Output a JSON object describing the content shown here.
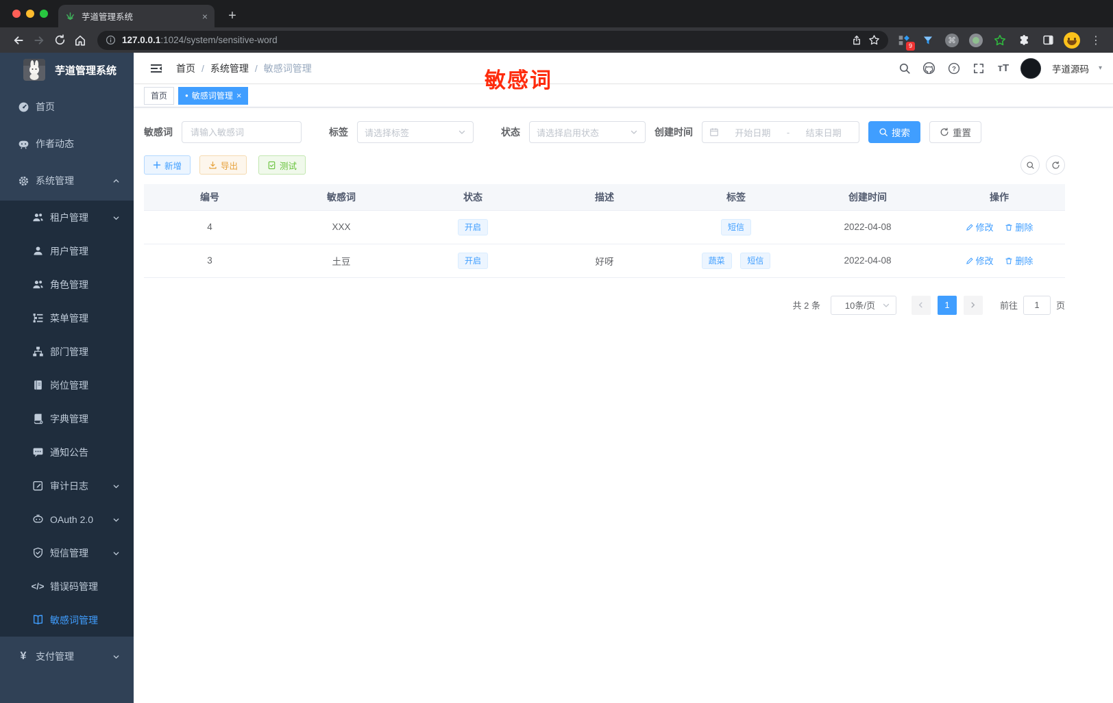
{
  "browser": {
    "tab_title": "芋道管理系统",
    "url_host": "127.0.0.1",
    "url_rest": ":1024/system/sensitive-word",
    "extension_badge": "9"
  },
  "icons": {
    "newtab": "+",
    "close": "×",
    "dot": "●",
    "question": "?",
    "command": "⌘",
    "fontsize": "тT",
    "kebab": "⋮",
    "code": "</>",
    "yen": "¥",
    "caret": "▾"
  },
  "sidebar": {
    "logo_title": "芋道管理系统",
    "items": [
      {
        "label": "首页"
      },
      {
        "label": "作者动态"
      },
      {
        "label": "系统管理"
      },
      {
        "label": "租户管理"
      },
      {
        "label": "用户管理"
      },
      {
        "label": "角色管理"
      },
      {
        "label": "菜单管理"
      },
      {
        "label": "部门管理"
      },
      {
        "label": "岗位管理"
      },
      {
        "label": "字典管理"
      },
      {
        "label": "通知公告"
      },
      {
        "label": "审计日志"
      },
      {
        "label": "OAuth 2.0"
      },
      {
        "label": "短信管理"
      },
      {
        "label": "错误码管理"
      },
      {
        "label": "敏感词管理"
      },
      {
        "label": "支付管理"
      }
    ]
  },
  "header": {
    "breadcrumb": [
      "首页",
      "系统管理",
      "敏感词管理"
    ],
    "separator": "/",
    "username": "芋道源码"
  },
  "tags": [
    {
      "label": "首页"
    },
    {
      "label": "敏感词管理"
    }
  ],
  "annotation": {
    "text": "敏感词",
    "color": "#fe2c0d"
  },
  "filters": {
    "keyword_label": "敏感词",
    "keyword_placeholder": "请输入敏感词",
    "tag_label": "标签",
    "tag_placeholder": "请选择标签",
    "status_label": "状态",
    "status_placeholder": "请选择启用状态",
    "date_label": "创建时间",
    "date_start": "开始日期",
    "date_sep": "-",
    "date_end": "结束日期",
    "search_label": "搜索",
    "reset_label": "重置"
  },
  "toolbar": {
    "add_label": "新增",
    "export_label": "导出",
    "test_label": "测试"
  },
  "table": {
    "columns": [
      "编号",
      "敏感词",
      "状态",
      "描述",
      "标签",
      "创建时间",
      "操作"
    ],
    "edit_label": "修改",
    "delete_label": "删除",
    "rows": [
      {
        "id": "4",
        "word": "XXX",
        "status": "开启",
        "description": "",
        "tags": [
          "短信"
        ],
        "created": "2022-04-08"
      },
      {
        "id": "3",
        "word": "土豆",
        "status": "开启",
        "description": "好呀",
        "tags": [
          "蔬菜",
          "短信"
        ],
        "created": "2022-04-08"
      }
    ]
  },
  "pagination": {
    "total": "共 2 条",
    "page_size": "10条/页",
    "current_page": "1",
    "goto_label": "前往",
    "goto_value": "1",
    "page_unit": "页"
  },
  "colors": {
    "accent": "#409eff",
    "sidebar_bg": "#304156",
    "submenu_bg": "#1f2d3d",
    "annotation_red": "#fe2c0d"
  }
}
